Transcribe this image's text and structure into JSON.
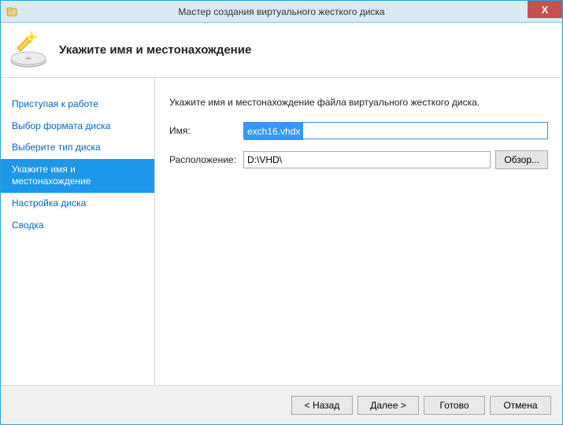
{
  "titlebar": {
    "title": "Мастер создания виртуального жесткого диска",
    "close": "X"
  },
  "header": {
    "title": "Укажите имя и местонахождение"
  },
  "sidebar": {
    "items": [
      {
        "label": "Приступая к работе",
        "active": false
      },
      {
        "label": "Выбор формата диска",
        "active": false
      },
      {
        "label": "Выберите тип диска",
        "active": false
      },
      {
        "label": "Укажите имя и местонахождение",
        "active": true
      },
      {
        "label": "Настройка диска",
        "active": false
      },
      {
        "label": "Сводка",
        "active": false
      }
    ]
  },
  "content": {
    "instruction": "Укажите имя и местонахождение файла виртуального жесткого диска.",
    "name_label": "Имя:",
    "name_value": "exch16.vhdx",
    "location_label": "Расположение:",
    "location_value": "D:\\VHD\\",
    "browse_label": "Обзор..."
  },
  "footer": {
    "back": "< Назад",
    "next": "Далее >",
    "finish": "Готово",
    "cancel": "Отмена"
  }
}
